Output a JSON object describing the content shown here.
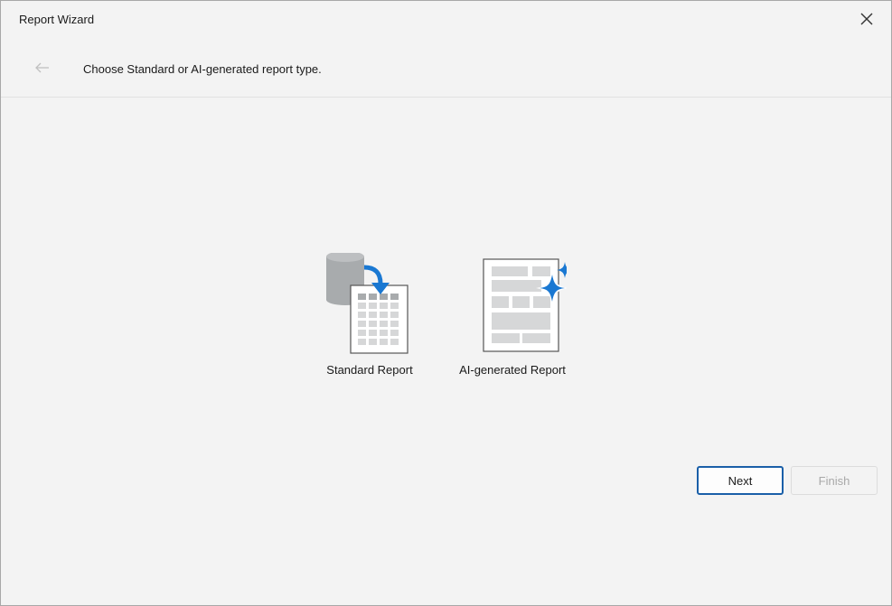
{
  "window": {
    "title": "Report Wizard"
  },
  "header": {
    "subtitle": "Choose Standard or AI-generated report type."
  },
  "options": [
    {
      "label": "Standard Report",
      "icon": "database-to-grid-report-icon"
    },
    {
      "label": "AI-generated Report",
      "icon": "sparkle-report-icon"
    }
  ],
  "footer": {
    "next_label": "Next",
    "finish_label": "Finish"
  },
  "colors": {
    "accent": "#1a78d2",
    "button_border": "#1a5fa8",
    "background": "#f3f3f3",
    "icon_gray": "#a8abad"
  }
}
